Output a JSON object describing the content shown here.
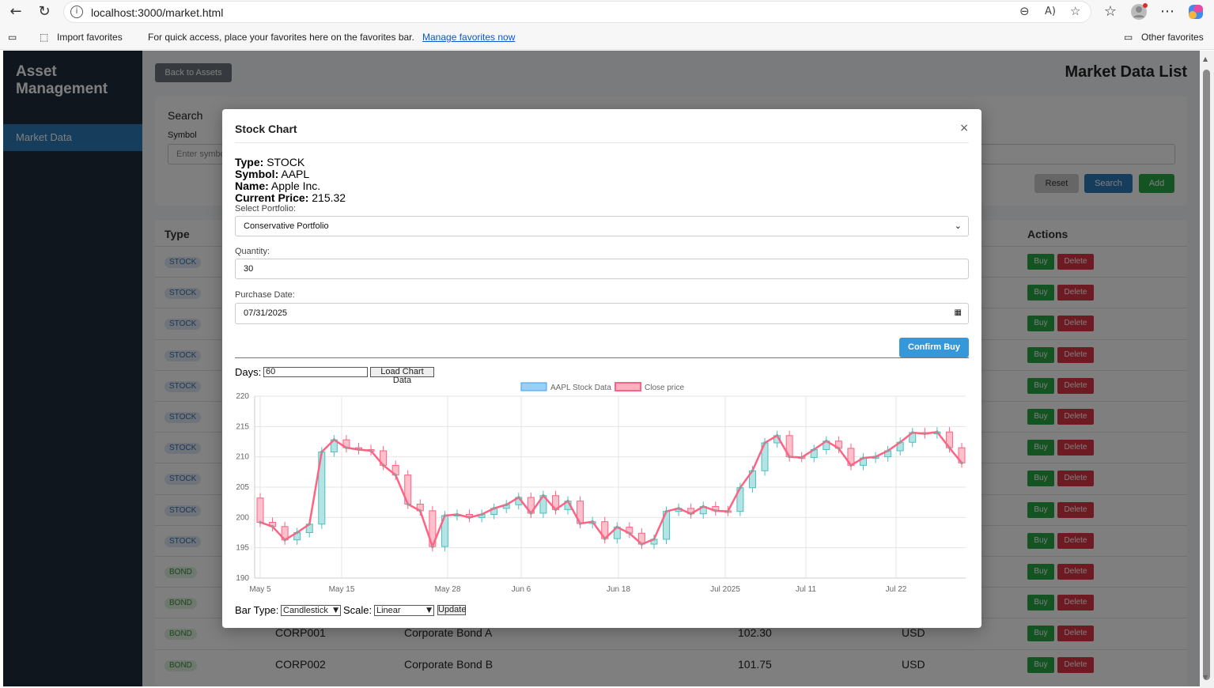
{
  "browser": {
    "url": "localhost:3000/market.html",
    "favorites_bar": {
      "import_label": "Import favorites",
      "message": "For quick access, place your favorites here on the favorites bar.",
      "manage_link": "Manage favorites now",
      "other_label": "Other favorites"
    }
  },
  "sidebar": {
    "brand": "Asset Management",
    "items": [
      {
        "label": "Market Data"
      }
    ]
  },
  "header": {
    "back_label": "Back to Assets",
    "title": "Market Data List"
  },
  "search": {
    "title": "Search",
    "symbol_label": "Symbol",
    "symbol_placeholder": "Enter symbol",
    "reset_label": "Reset",
    "search_label": "Search",
    "add_label": "Add"
  },
  "table": {
    "headers": {
      "type": "Type",
      "actions": "Actions"
    },
    "buy_label": "Buy",
    "delete_label": "Delete",
    "rows": [
      {
        "type": "STOCK"
      },
      {
        "type": "STOCK"
      },
      {
        "type": "STOCK"
      },
      {
        "type": "STOCK"
      },
      {
        "type": "STOCK"
      },
      {
        "type": "STOCK"
      },
      {
        "type": "STOCK"
      },
      {
        "type": "STOCK"
      },
      {
        "type": "STOCK"
      },
      {
        "type": "STOCK"
      },
      {
        "type": "BOND"
      },
      {
        "type": "BOND"
      },
      {
        "type": "BOND",
        "symbol": "CORP001",
        "name": "Corporate Bond A",
        "price": "102.30",
        "currency": "USD"
      },
      {
        "type": "BOND",
        "symbol": "CORP002",
        "name": "Corporate Bond B",
        "price": "101.75",
        "currency": "USD"
      }
    ]
  },
  "modal": {
    "title": "Stock Chart",
    "close": "×",
    "type_label": "Type:",
    "type_value": "STOCK",
    "symbol_label": "Symbol:",
    "symbol_value": "AAPL",
    "name_label": "Name:",
    "name_value": "Apple Inc.",
    "price_label": "Current Price:",
    "price_value": "215.32",
    "portfolio_label": "Select Portfolio:",
    "portfolio_value": "Conservative Portfolio",
    "quantity_label": "Quantity:",
    "quantity_value": "30",
    "date_label": "Purchase Date:",
    "date_value": "07/31/2025",
    "confirm_label": "Confirm Buy",
    "days_label": "Days:",
    "days_value": "60",
    "load_label": "Load Chart Data",
    "bar_type_label": "Bar Type:",
    "bar_type_value": "Candlestick",
    "scale_label": "Scale:",
    "scale_value": "Linear",
    "update_label": "Update"
  },
  "colors": {
    "up": "#4bc0c0",
    "down": "#ff6384",
    "accent": "#3498db"
  },
  "chart_data": {
    "type": "line",
    "subtype": "candlestick",
    "legend": [
      "AAPL Stock Data",
      "Close price"
    ],
    "legend_position": "top",
    "ylim": [
      190,
      220
    ],
    "yticks": [
      190,
      195,
      200,
      205,
      210,
      215,
      220
    ],
    "xtick_labels": [
      "May 5",
      "May 15",
      "May 28",
      "Jun 6",
      "Jun 18",
      "Jul 2025",
      "Jul 11",
      "Jul 22"
    ],
    "grid": true,
    "close": [
      199.2,
      198.5,
      196.3,
      197.5,
      198.9,
      210.8,
      212.8,
      211.5,
      211.2,
      211.0,
      208.6,
      207.0,
      202.2,
      201.1,
      195.2,
      200.3,
      200.5,
      200.0,
      200.5,
      201.5,
      202.1,
      203.3,
      200.7,
      203.6,
      201.3,
      202.7,
      199.0,
      199.3,
      196.5,
      198.4,
      197.4,
      195.6,
      196.4,
      201.0,
      201.5,
      200.6,
      201.8,
      201.1,
      201.0,
      204.9,
      207.7,
      212.3,
      213.5,
      210.0,
      209.9,
      211.2,
      212.6,
      211.4,
      208.6,
      209.8,
      210.0,
      211.0,
      212.4,
      214.0,
      213.8,
      214.1,
      211.5,
      209.0
    ]
  }
}
